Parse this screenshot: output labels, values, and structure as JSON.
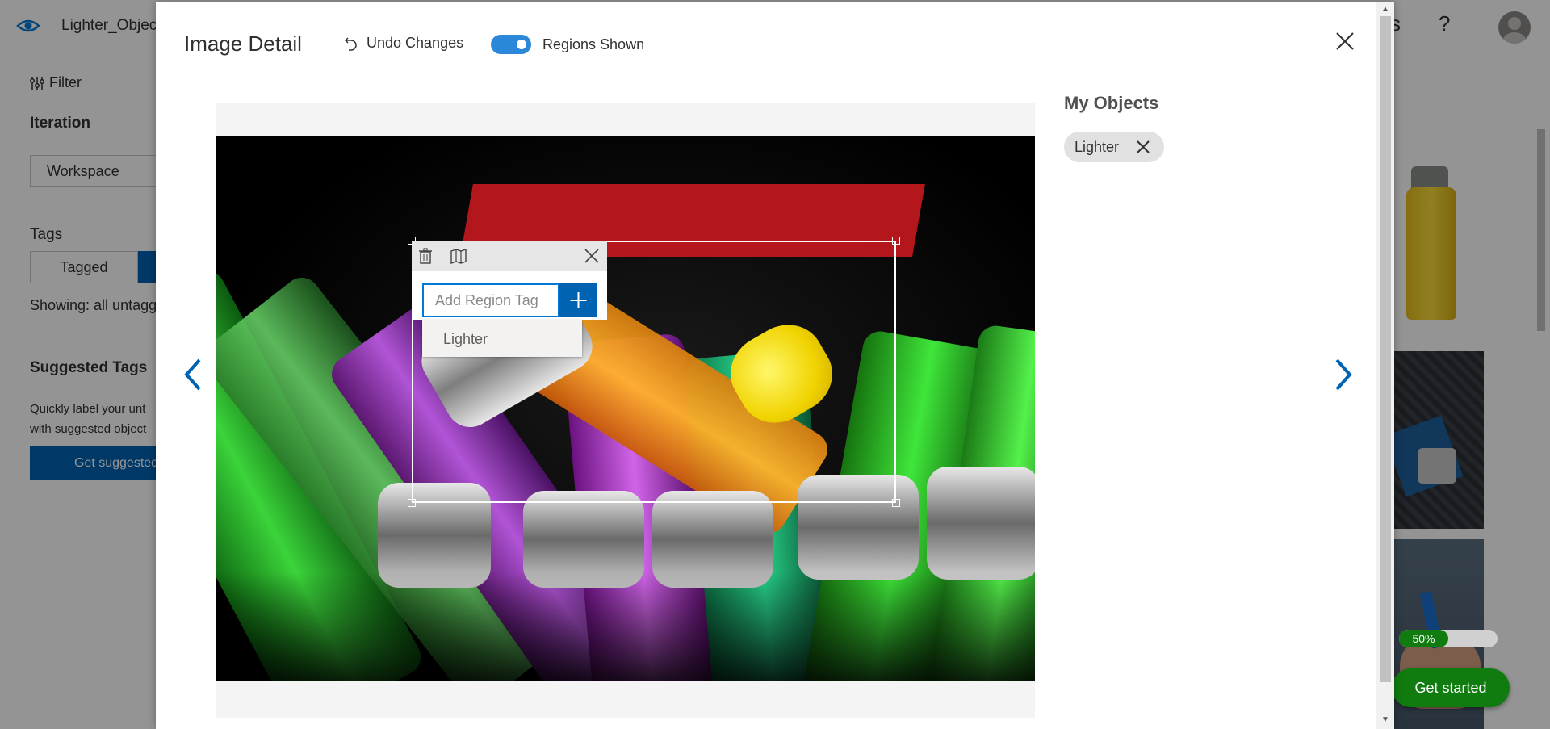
{
  "app": {
    "project_name": "Lighter_Object",
    "help_glyph": "?",
    "top_right_partial": "s",
    "icons": [
      "eye-icon",
      "help-icon",
      "avatar"
    ]
  },
  "sidebar": {
    "filter_label": "Filter",
    "iteration_heading": "Iteration",
    "iteration_value": "Workspace",
    "tags_heading": "Tags",
    "tagged_label": "Tagged",
    "showing_text": "Showing: all untagg",
    "suggested_heading": "Suggested Tags",
    "suggested_desc_line1": "Quickly label your unt",
    "suggested_desc_line2": "with suggested object",
    "get_suggested_label": "Get suggested"
  },
  "background_panel": {
    "progress_percent": 50,
    "progress_label": "50%",
    "get_started_label": "Get started"
  },
  "modal": {
    "title": "Image Detail",
    "undo_label": "Undo Changes",
    "regions_label": "Regions Shown",
    "regions_on": true,
    "objects_heading": "My Objects",
    "object_tags": [
      {
        "label": "Lighter"
      }
    ]
  },
  "region_editor": {
    "input_placeholder": "Add Region Tag",
    "input_value": "",
    "suggestions": [
      {
        "label": "Lighter"
      }
    ]
  },
  "colors": {
    "accent": "#0063b1",
    "toggle_on": "#2b88d8",
    "success": "#107c10"
  }
}
